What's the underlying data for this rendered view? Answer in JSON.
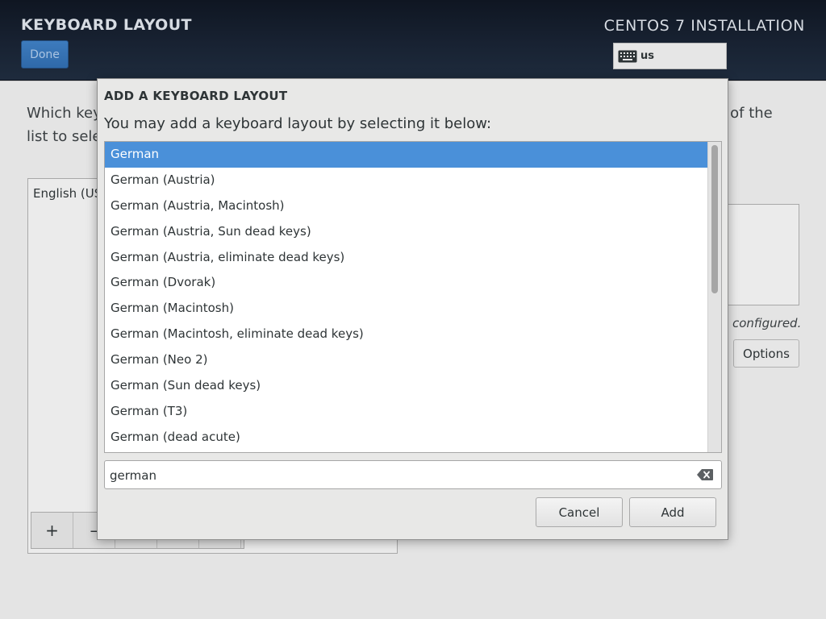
{
  "header": {
    "title": "KEYBOARD LAYOUT",
    "done_label": "Done",
    "install_title": "CENTOS 7 INSTALLATION",
    "keyboard_indicator": "us"
  },
  "background": {
    "instruction_left_line1": "Which key",
    "instruction_left_line2": "list to sele",
    "instruction_right": "p of the",
    "layout_item": "English (US",
    "add_symbol": "+",
    "remove_symbol": "–",
    "configured_text": "configured.",
    "options_label": "Options"
  },
  "dialog": {
    "title": "ADD A KEYBOARD LAYOUT",
    "subtitle": "You may add a keyboard layout by selecting it below:",
    "layouts": [
      "German",
      "German (Austria)",
      "German (Austria, Macintosh)",
      "German (Austria, Sun dead keys)",
      "German (Austria, eliminate dead keys)",
      "German (Dvorak)",
      "German (Macintosh)",
      "German (Macintosh, eliminate dead keys)",
      "German (Neo 2)",
      "German (Sun dead keys)",
      "German (T3)",
      "German (dead acute)"
    ],
    "selected_index": 0,
    "search_value": "german",
    "cancel_label": "Cancel",
    "add_label": "Add"
  },
  "colors": {
    "selection": "#4a90d9",
    "header_bg": "#182232",
    "done_button": "#3371b3"
  },
  "icons": {
    "keyboard": "keyboard-icon",
    "clear": "clear-text-icon"
  }
}
